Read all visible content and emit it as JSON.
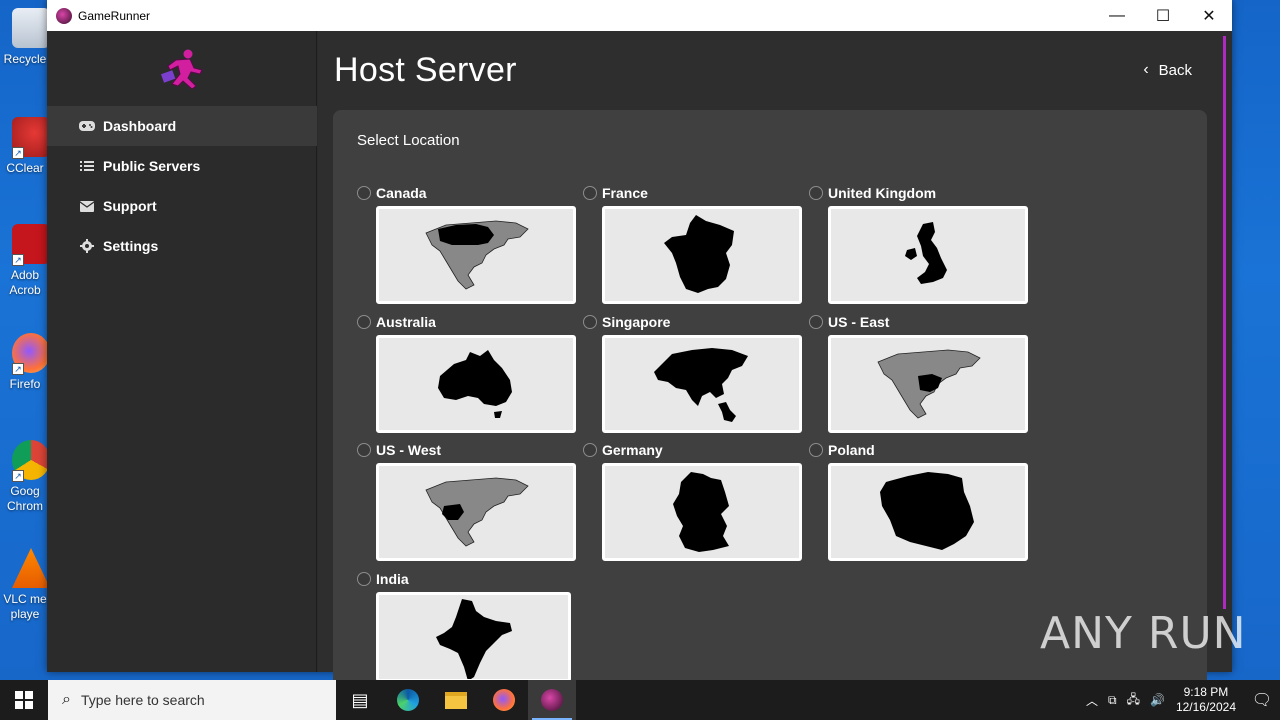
{
  "desktop": {
    "icons": [
      {
        "label": "Recycle",
        "icon": "recycle-bin-icon"
      },
      {
        "label": "CClear",
        "icon": "ccleaner-icon"
      },
      {
        "label": "Adob Acrob",
        "icon": "adobe-acrobat-icon"
      },
      {
        "label": "Firefo",
        "icon": "firefox-icon"
      },
      {
        "label": "Goog Chrom",
        "icon": "chrome-icon"
      },
      {
        "label": "VLC me playe",
        "icon": "vlc-icon"
      }
    ]
  },
  "window": {
    "title": "GameRunner",
    "controls": {
      "minimize": "—",
      "maximize": "☐",
      "close": "✕"
    }
  },
  "sidebar": {
    "items": [
      {
        "label": "Dashboard",
        "icon": "gamepad-icon",
        "active": true
      },
      {
        "label": "Public Servers",
        "icon": "list-icon",
        "active": false
      },
      {
        "label": "Support",
        "icon": "envelope-icon",
        "active": false
      },
      {
        "label": "Settings",
        "icon": "gear-icon",
        "active": false
      }
    ]
  },
  "main": {
    "title": "Host Server",
    "back_label": "Back",
    "panel_title": "Select Location",
    "locations": [
      {
        "label": "Canada",
        "map": "north-america-canada"
      },
      {
        "label": "France",
        "map": "france"
      },
      {
        "label": "United Kingdom",
        "map": "united-kingdom"
      },
      {
        "label": "Australia",
        "map": "australia"
      },
      {
        "label": "Singapore",
        "map": "asia"
      },
      {
        "label": "US - East",
        "map": "north-america-us-east"
      },
      {
        "label": "US - West",
        "map": "north-america-us-west"
      },
      {
        "label": "Germany",
        "map": "germany"
      },
      {
        "label": "Poland",
        "map": "poland"
      },
      {
        "label": "India",
        "map": "india"
      }
    ]
  },
  "taskbar": {
    "search_placeholder": "Type here to search",
    "time": "9:18 PM",
    "date": "12/16/2024"
  },
  "watermark": "ANY RUN",
  "colors": {
    "accent": "#b02ac0",
    "window_bg": "#2b2b2b",
    "panel_bg": "#404040"
  }
}
